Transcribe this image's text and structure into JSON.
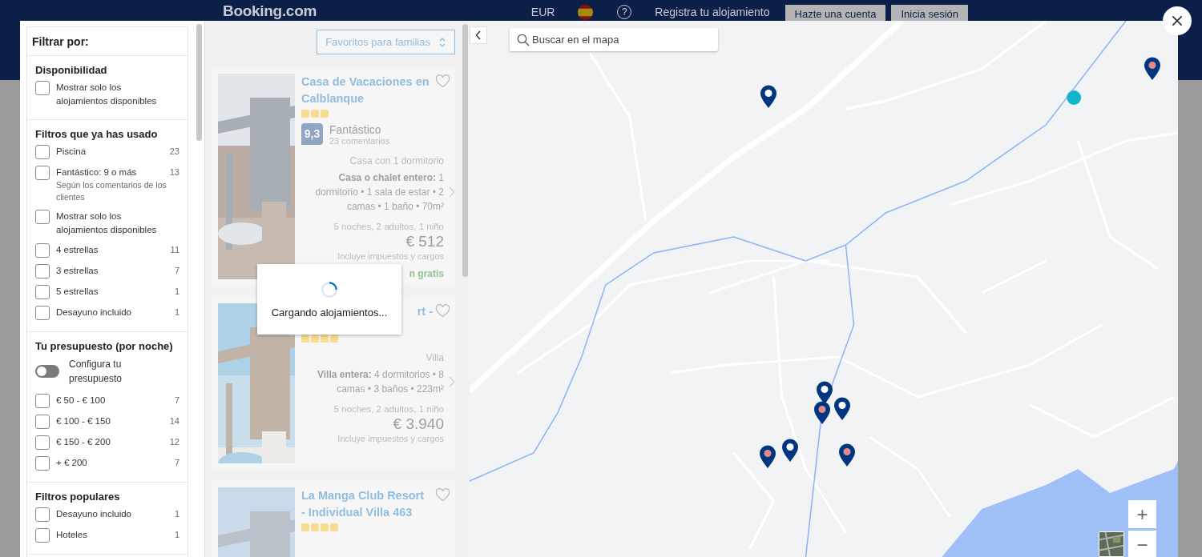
{
  "header": {
    "logo": "Booking.com",
    "currency": "EUR",
    "help": "?",
    "register": "Registra tu alojamiento",
    "buttons": [
      {
        "label": "Hazte una cuenta"
      },
      {
        "label": "Inicia sesión"
      }
    ]
  },
  "filters": {
    "title": "Filtrar por:",
    "sections": [
      {
        "heading": "Disponibilidad",
        "items": [
          {
            "kind": "checkbox",
            "label": "Mostrar solo los alojamientos disponibles",
            "checked": false
          }
        ]
      },
      {
        "heading": "Filtros que ya has usado",
        "items": [
          {
            "kind": "checkbox",
            "label": "Piscina",
            "count": "23",
            "checked": false
          },
          {
            "kind": "checkbox",
            "label": "Fantástico: 9 o más",
            "count": "13",
            "note": "Según los comentarios de los clientes",
            "checked": false
          },
          {
            "kind": "checkbox",
            "label": "Mostrar solo los alojamientos disponibles",
            "checked": false
          },
          {
            "kind": "checkbox",
            "label": "4 estrellas",
            "count": "11",
            "checked": false
          },
          {
            "kind": "checkbox",
            "label": "3 estrellas",
            "count": "7",
            "checked": false
          },
          {
            "kind": "checkbox",
            "label": "5 estrellas",
            "count": "1",
            "checked": false
          },
          {
            "kind": "checkbox",
            "label": "Desayuno incluido",
            "count": "1",
            "checked": false
          }
        ]
      },
      {
        "heading": "Tu presupuesto (por noche)",
        "items": [
          {
            "kind": "toggle",
            "label": "Configura tu presupuesto",
            "on": false
          },
          {
            "kind": "checkbox",
            "label": "€ 50 - € 100",
            "count": "7",
            "checked": false
          },
          {
            "kind": "checkbox",
            "label": "€ 100 - € 150",
            "count": "14",
            "checked": false
          },
          {
            "kind": "checkbox",
            "label": "€ 150 - € 200",
            "count": "12",
            "checked": false
          },
          {
            "kind": "checkbox",
            "label": "+ € 200",
            "count": "7",
            "checked": false
          }
        ]
      },
      {
        "heading": "Filtros populares",
        "items": [
          {
            "kind": "checkbox",
            "label": "Desayuno incluido",
            "count": "1",
            "checked": false
          },
          {
            "kind": "checkbox",
            "label": "Hoteles",
            "count": "1",
            "checked": false
          }
        ]
      }
    ]
  },
  "list": {
    "sort": "Favoritos para familias",
    "loading": "Cargando alojamientos...",
    "cards": [
      {
        "title": "Casa de Vacaciones en Calblanque",
        "partial": false,
        "stars": 3,
        "score": "9,3",
        "rating": "Fantástico",
        "reviews": "23 comentarios",
        "type": "Casa con 1 dormitorio",
        "details": "**Casa o chalet entero:** 1 dormitorio • 1 sala de estar • 2 camas • 1 baño • 70m²",
        "stay": "5 noches, 2 adultos, 1 niño",
        "price": "€ 512",
        "taxes": "Incluye impuestos y cargos",
        "note": "n gratis"
      },
      {
        "title": "rt -",
        "partial": true,
        "stars": 4,
        "type": "Villa",
        "details": "**Villa entera:** 4 dormitorios • 8 camas • 3 baños • 223m²",
        "stay": "5 noches, 2 adultos, 1 niño",
        "price": "€ 3.940",
        "taxes": "Incluye impuestos y cargos"
      },
      {
        "title": "La Manga Club Resort - Individual Villa 463",
        "partial": false,
        "stars": 4
      }
    ]
  },
  "map": {
    "kind": "picture",
    "search": {
      "placeholder": "Buscar en el mapa"
    },
    "zoom_in": "+",
    "zoom_out": "−",
    "pins": [
      {
        "kind": "plain"
      },
      {
        "kind": "dot"
      },
      {
        "kind": "plain"
      },
      {
        "kind": "dot"
      },
      {
        "kind": "plain"
      },
      {
        "kind": "dot"
      },
      {
        "kind": "plain"
      },
      {
        "kind": "dot"
      }
    ]
  }
}
